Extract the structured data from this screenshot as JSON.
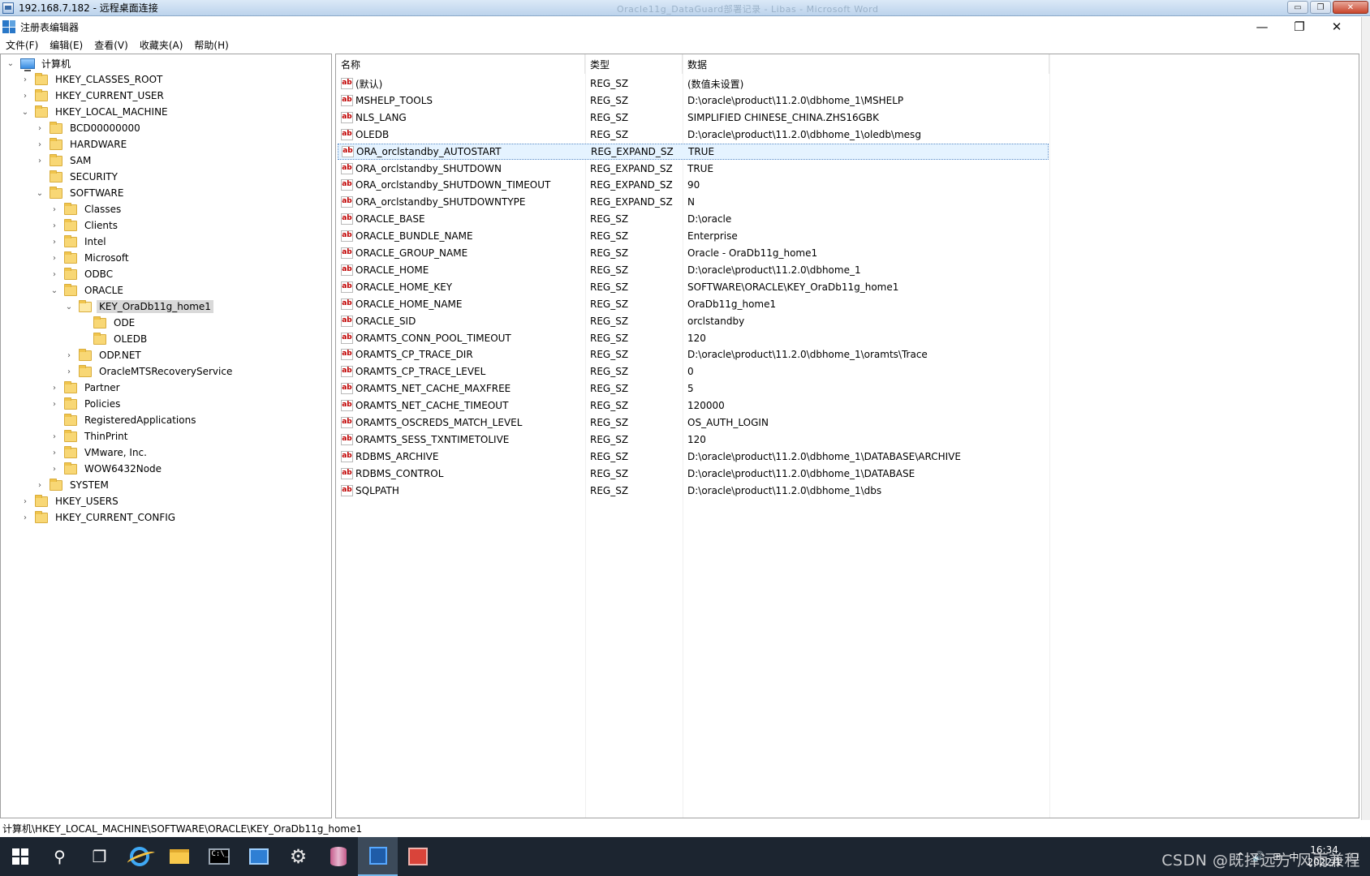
{
  "rdp": {
    "title": "192.168.7.182 - 远程桌面连接",
    "faded_title": "Oracle11g_DataGuard部署记录 - Libas - Microsoft Word",
    "minimize": "▭",
    "restore": "❐",
    "close": "✕"
  },
  "app": {
    "title": "注册表编辑器",
    "minimize": "—",
    "restore": "❐",
    "close": "✕"
  },
  "menu": [
    "文件(F)",
    "编辑(E)",
    "查看(V)",
    "收藏夹(A)",
    "帮助(H)"
  ],
  "tree": [
    {
      "label": "计算机",
      "level": 0,
      "expander": "expanded",
      "icon": "computer-icon"
    },
    {
      "label": "HKEY_CLASSES_ROOT",
      "level": 1,
      "expander": "collapsed",
      "icon": "folder-icon"
    },
    {
      "label": "HKEY_CURRENT_USER",
      "level": 1,
      "expander": "collapsed",
      "icon": "folder-icon"
    },
    {
      "label": "HKEY_LOCAL_MACHINE",
      "level": 1,
      "expander": "expanded",
      "icon": "folder-icon"
    },
    {
      "label": "BCD00000000",
      "level": 2,
      "expander": "collapsed",
      "icon": "folder-icon"
    },
    {
      "label": "HARDWARE",
      "level": 2,
      "expander": "collapsed",
      "icon": "folder-icon"
    },
    {
      "label": "SAM",
      "level": 2,
      "expander": "collapsed",
      "icon": "folder-icon"
    },
    {
      "label": "SECURITY",
      "level": 2,
      "expander": "none",
      "icon": "folder-icon"
    },
    {
      "label": "SOFTWARE",
      "level": 2,
      "expander": "expanded",
      "icon": "folder-icon"
    },
    {
      "label": "Classes",
      "level": 3,
      "expander": "collapsed",
      "icon": "folder-icon"
    },
    {
      "label": "Clients",
      "level": 3,
      "expander": "collapsed",
      "icon": "folder-icon"
    },
    {
      "label": "Intel",
      "level": 3,
      "expander": "collapsed",
      "icon": "folder-icon"
    },
    {
      "label": "Microsoft",
      "level": 3,
      "expander": "collapsed",
      "icon": "folder-icon"
    },
    {
      "label": "ODBC",
      "level": 3,
      "expander": "collapsed",
      "icon": "folder-icon"
    },
    {
      "label": "ORACLE",
      "level": 3,
      "expander": "expanded",
      "icon": "folder-icon"
    },
    {
      "label": "KEY_OraDb11g_home1",
      "level": 4,
      "expander": "expanded",
      "icon": "folder-icon",
      "selected": true
    },
    {
      "label": "ODE",
      "level": 5,
      "expander": "none",
      "icon": "folder-icon"
    },
    {
      "label": "OLEDB",
      "level": 5,
      "expander": "none",
      "icon": "folder-icon"
    },
    {
      "label": "ODP.NET",
      "level": 4,
      "expander": "collapsed",
      "icon": "folder-icon"
    },
    {
      "label": "OracleMTSRecoveryService",
      "level": 4,
      "expander": "collapsed",
      "icon": "folder-icon"
    },
    {
      "label": "Partner",
      "level": 3,
      "expander": "collapsed",
      "icon": "folder-icon"
    },
    {
      "label": "Policies",
      "level": 3,
      "expander": "collapsed",
      "icon": "folder-icon"
    },
    {
      "label": "RegisteredApplications",
      "level": 3,
      "expander": "none",
      "icon": "folder-icon"
    },
    {
      "label": "ThinPrint",
      "level": 3,
      "expander": "collapsed",
      "icon": "folder-icon"
    },
    {
      "label": "VMware, Inc.",
      "level": 3,
      "expander": "collapsed",
      "icon": "folder-icon"
    },
    {
      "label": "WOW6432Node",
      "level": 3,
      "expander": "collapsed",
      "icon": "folder-icon"
    },
    {
      "label": "SYSTEM",
      "level": 2,
      "expander": "collapsed",
      "icon": "folder-icon"
    },
    {
      "label": "HKEY_USERS",
      "level": 1,
      "expander": "collapsed",
      "icon": "folder-icon"
    },
    {
      "label": "HKEY_CURRENT_CONFIG",
      "level": 1,
      "expander": "collapsed",
      "icon": "folder-icon"
    }
  ],
  "list": {
    "columns": [
      "名称",
      "类型",
      "数据"
    ],
    "icon_text": "ab",
    "rows": [
      {
        "name": "(默认)",
        "type": "REG_SZ",
        "data": "(数值未设置)"
      },
      {
        "name": "MSHELP_TOOLS",
        "type": "REG_SZ",
        "data": "D:\\oracle\\product\\11.2.0\\dbhome_1\\MSHELP"
      },
      {
        "name": "NLS_LANG",
        "type": "REG_SZ",
        "data": "SIMPLIFIED CHINESE_CHINA.ZHS16GBK"
      },
      {
        "name": "OLEDB",
        "type": "REG_SZ",
        "data": "D:\\oracle\\product\\11.2.0\\dbhome_1\\oledb\\mesg"
      },
      {
        "name": "ORA_orclstandby_AUTOSTART",
        "type": "REG_EXPAND_SZ",
        "data": "TRUE",
        "selected": true
      },
      {
        "name": "ORA_orclstandby_SHUTDOWN",
        "type": "REG_EXPAND_SZ",
        "data": "TRUE"
      },
      {
        "name": "ORA_orclstandby_SHUTDOWN_TIMEOUT",
        "type": "REG_EXPAND_SZ",
        "data": "90"
      },
      {
        "name": "ORA_orclstandby_SHUTDOWNTYPE",
        "type": "REG_EXPAND_SZ",
        "data": "N"
      },
      {
        "name": "ORACLE_BASE",
        "type": "REG_SZ",
        "data": "D:\\oracle"
      },
      {
        "name": "ORACLE_BUNDLE_NAME",
        "type": "REG_SZ",
        "data": "Enterprise"
      },
      {
        "name": "ORACLE_GROUP_NAME",
        "type": "REG_SZ",
        "data": "Oracle - OraDb11g_home1"
      },
      {
        "name": "ORACLE_HOME",
        "type": "REG_SZ",
        "data": "D:\\oracle\\product\\11.2.0\\dbhome_1"
      },
      {
        "name": "ORACLE_HOME_KEY",
        "type": "REG_SZ",
        "data": "SOFTWARE\\ORACLE\\KEY_OraDb11g_home1"
      },
      {
        "name": "ORACLE_HOME_NAME",
        "type": "REG_SZ",
        "data": "OraDb11g_home1"
      },
      {
        "name": "ORACLE_SID",
        "type": "REG_SZ",
        "data": "orclstandby"
      },
      {
        "name": "ORAMTS_CONN_POOL_TIMEOUT",
        "type": "REG_SZ",
        "data": "120"
      },
      {
        "name": "ORAMTS_CP_TRACE_DIR",
        "type": "REG_SZ",
        "data": "D:\\oracle\\product\\11.2.0\\dbhome_1\\oramts\\Trace"
      },
      {
        "name": "ORAMTS_CP_TRACE_LEVEL",
        "type": "REG_SZ",
        "data": "0"
      },
      {
        "name": "ORAMTS_NET_CACHE_MAXFREE",
        "type": "REG_SZ",
        "data": "5"
      },
      {
        "name": "ORAMTS_NET_CACHE_TIMEOUT",
        "type": "REG_SZ",
        "data": "120000"
      },
      {
        "name": "ORAMTS_OSCREDS_MATCH_LEVEL",
        "type": "REG_SZ",
        "data": "OS_AUTH_LOGIN"
      },
      {
        "name": "ORAMTS_SESS_TXNTIMETOLIVE",
        "type": "REG_SZ",
        "data": "120"
      },
      {
        "name": "RDBMS_ARCHIVE",
        "type": "REG_SZ",
        "data": "D:\\oracle\\product\\11.2.0\\dbhome_1\\DATABASE\\ARCHIVE"
      },
      {
        "name": "RDBMS_CONTROL",
        "type": "REG_SZ",
        "data": "D:\\oracle\\product\\11.2.0\\dbhome_1\\DATABASE"
      },
      {
        "name": "SQLPATH",
        "type": "REG_SZ",
        "data": "D:\\oracle\\product\\11.2.0\\dbhome_1\\dbs"
      }
    ]
  },
  "status": {
    "path": "计算机\\HKEY_LOCAL_MACHINE\\SOFTWARE\\ORACLE\\KEY_OraDb11g_home1"
  },
  "taskbar": {
    "apps": [
      "start-icon",
      "search-icon",
      "task-view-icon",
      "internet-explorer-icon",
      "file-explorer-icon",
      "command-prompt-icon",
      "server-manager-icon",
      "settings-gear-icon",
      "database-icon",
      "registry-editor-icon",
      "red-app-icon"
    ],
    "active": "registry-editor-icon",
    "search_glyph": "⚲",
    "taskview_glyph": "❐",
    "gear_glyph": "⚙",
    "cmd_text": "C:\\_",
    "tray_up": "^",
    "tray_volume": "🔊",
    "tray_network": "⊞",
    "tray_ime": "中",
    "time": "16:34",
    "date": "2022/1",
    "notify": "▢"
  },
  "watermark": "CSDN @既择远方 风雨兼程"
}
